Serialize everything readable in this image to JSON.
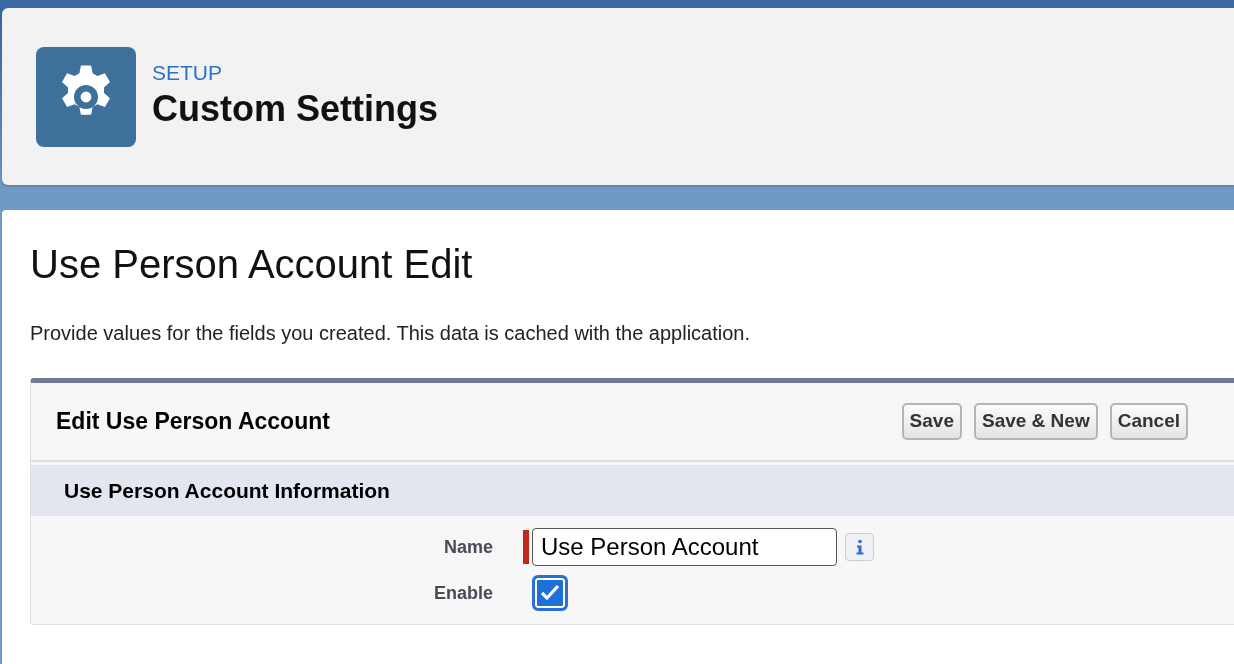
{
  "header": {
    "eyebrow": "SETUP",
    "title": "Custom Settings"
  },
  "page": {
    "title": "Use Person Account Edit",
    "description": "Provide values for the fields you created. This data is cached with the application."
  },
  "edit_block": {
    "title": "Edit Use Person Account",
    "buttons": [
      "Save",
      "Save & New",
      "Cancel"
    ],
    "section": "Use Person Account Information",
    "fields": [
      {
        "kind": "text",
        "label": "Name",
        "value": "Use Person Account",
        "required": true,
        "info": true
      },
      {
        "kind": "checkbox",
        "label": "Enable",
        "checked": true
      }
    ]
  }
}
